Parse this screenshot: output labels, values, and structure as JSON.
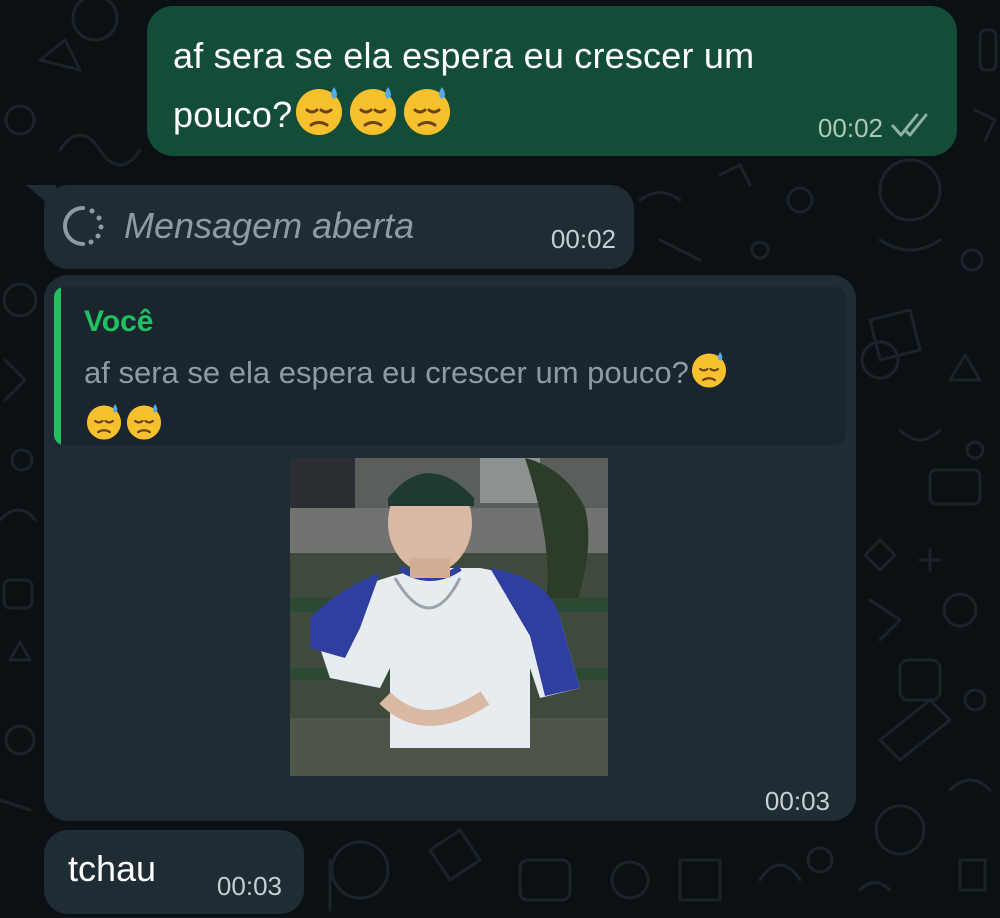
{
  "messages": {
    "outgoing": {
      "text": "af sera se ela espera eu crescer um pouco?",
      "emoji": [
        "downcast-sweat-face",
        "downcast-sweat-face",
        "downcast-sweat-face"
      ],
      "time": "00:02",
      "status": "read-double-check"
    },
    "view_once": {
      "label": "Mensagem aberta",
      "time": "00:02",
      "icon": "view-once-icon"
    },
    "reply": {
      "quoted_author": "Você",
      "quoted_text": "af sera se ela espera eu crescer um pouco?",
      "quoted_emoji": [
        "downcast-sweat-face",
        "downcast-sweat-face",
        "downcast-sweat-face"
      ],
      "time": "00:03",
      "media": "sticker-photo-boy-on-bench"
    },
    "last": {
      "text": "tchau",
      "time": "00:03"
    }
  },
  "colors": {
    "background": "#0b1014",
    "outgoing_bubble": "#144d37",
    "incoming_bubble": "#1f2c34",
    "quote_accent": "#21c063",
    "read_tick": "#8fb0a3"
  }
}
